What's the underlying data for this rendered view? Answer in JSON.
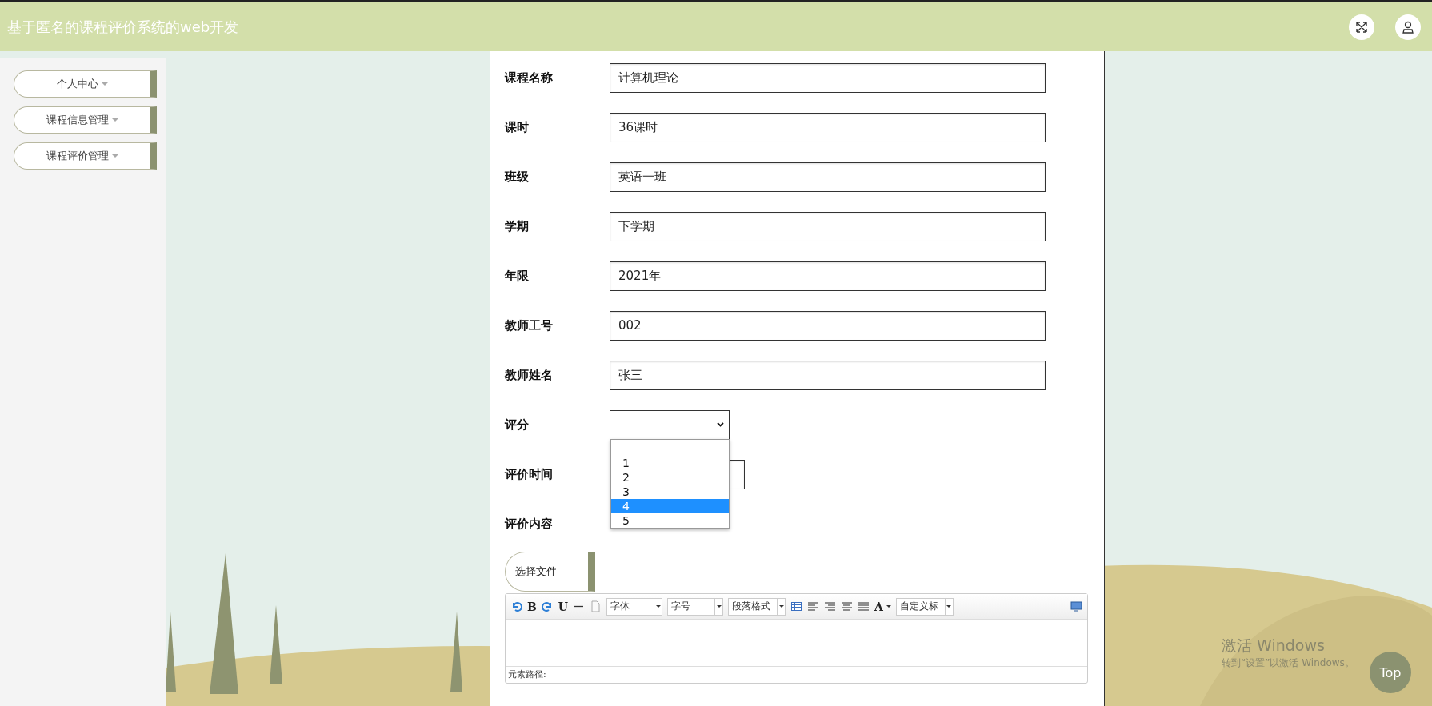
{
  "header": {
    "title": "基于匿名的课程评价系统的web开发",
    "actions": [
      {
        "kind": "fullscreen"
      },
      {
        "kind": "user"
      }
    ]
  },
  "sidebar": {
    "items": [
      {
        "label": "个人中心"
      },
      {
        "label": "课程信息管理"
      },
      {
        "label": "课程评价管理"
      }
    ]
  },
  "form": {
    "fields": [
      {
        "kind": "text",
        "label": "课程名称",
        "value": "计算机理论"
      },
      {
        "kind": "text",
        "label": "课时",
        "value": "36课时"
      },
      {
        "kind": "text",
        "label": "班级",
        "value": "英语一班"
      },
      {
        "kind": "text",
        "label": "学期",
        "value": "下学期"
      },
      {
        "kind": "text",
        "label": "年限",
        "value": "2021年"
      },
      {
        "kind": "text",
        "label": "教师工号",
        "value": "002"
      },
      {
        "kind": "text",
        "label": "教师姓名",
        "value": "张三"
      },
      {
        "kind": "select",
        "label": "评分",
        "expanded": true,
        "options": [
          {
            "label": "1",
            "selected": false
          },
          {
            "label": "2",
            "selected": false
          },
          {
            "label": "3",
            "selected": false
          },
          {
            "label": "4",
            "selected": true
          },
          {
            "label": "5",
            "selected": false
          }
        ]
      },
      {
        "kind": "short",
        "label": "评价时间"
      },
      {
        "kind": "label",
        "label": "评价内容"
      }
    ],
    "file_button": "选择文件",
    "editor": {
      "toolbar": [
        {
          "kind": "undo"
        },
        {
          "kind": "bold",
          "label": "B"
        },
        {
          "kind": "redo"
        },
        {
          "kind": "underline",
          "label": "U"
        },
        {
          "kind": "hr"
        },
        {
          "kind": "page"
        },
        {
          "kind": "select",
          "label": "字体"
        },
        {
          "kind": "select",
          "label": "字号"
        },
        {
          "kind": "select",
          "label": "段落格式"
        },
        {
          "kind": "table"
        },
        {
          "kind": "align-left"
        },
        {
          "kind": "align-right"
        },
        {
          "kind": "align-center"
        },
        {
          "kind": "justify"
        },
        {
          "kind": "color",
          "label": "A"
        },
        {
          "kind": "select",
          "label": "自定义标"
        },
        {
          "kind": "preview"
        }
      ],
      "path_label": "元素路径:"
    }
  },
  "top_button": "Top",
  "os_notice": {
    "title": "激活 Windows",
    "text": "转到“设置”以激活 Windows。"
  }
}
